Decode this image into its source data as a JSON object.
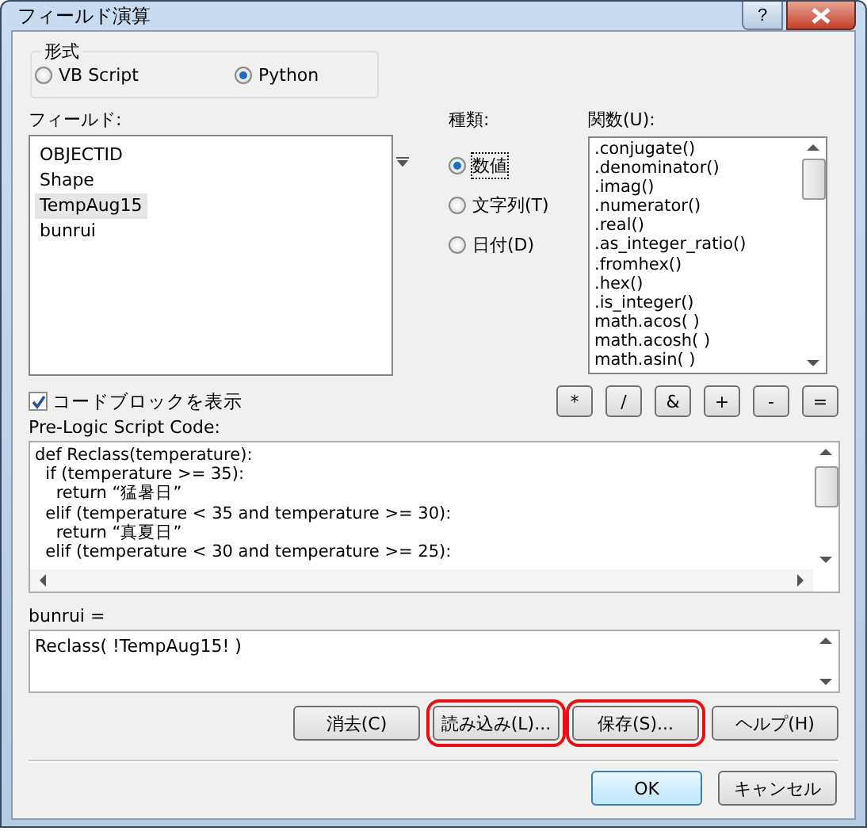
{
  "window": {
    "title": "フィールド演算",
    "help_button": "?"
  },
  "format": {
    "label": "形式",
    "options": [
      {
        "label": "VB Script",
        "selected": false
      },
      {
        "label": "Python",
        "selected": true
      }
    ]
  },
  "fields": {
    "label": "フィールド:",
    "items": [
      {
        "label": "OBJECTID",
        "selected": false
      },
      {
        "label": "Shape",
        "selected": false
      },
      {
        "label": "TempAug15",
        "selected": true
      },
      {
        "label": "bunrui",
        "selected": false
      }
    ]
  },
  "types": {
    "label": "種類:",
    "options": [
      {
        "label": "数値",
        "selected": true
      },
      {
        "label": "文字列(T)",
        "selected": false
      },
      {
        "label": "日付(D)",
        "selected": false
      }
    ]
  },
  "functions": {
    "label": "関数(U):",
    "items": [
      ".conjugate()",
      ".denominator()",
      ".imag()",
      ".numerator()",
      ".real()",
      ".as_integer_ratio()",
      ".fromhex()",
      ".hex()",
      ".is_integer()",
      "math.acos( )",
      "math.acosh( )",
      "math.asin( )"
    ]
  },
  "show_code_block": {
    "label": "コードブロックを表示",
    "checked": true
  },
  "operators": [
    "*",
    "/",
    "&",
    "+",
    "-",
    "="
  ],
  "pre_logic": {
    "label": "Pre-Logic Script Code:",
    "lines": [
      "def Reclass(temperature):",
      "  if (temperature >= 35):",
      "    return “猛暑日”",
      "  elif (temperature < 35 and temperature >= 30):",
      "    return “真夏日”",
      "  elif (temperature < 30 and temperature >= 25):"
    ]
  },
  "expression": {
    "label": "bunrui =",
    "value": "Reclass( !TempAug15! )"
  },
  "buttons": [
    {
      "label": "消去(C)",
      "highlighted": false
    },
    {
      "label": "読み込み(L)...",
      "highlighted": true
    },
    {
      "label": "保存(S)...",
      "highlighted": true
    },
    {
      "label": "ヘルプ(H)",
      "highlighted": false
    }
  ],
  "dialog_buttons": [
    {
      "label": "OK",
      "default": true
    },
    {
      "label": "キャンセル",
      "default": false
    }
  ]
}
